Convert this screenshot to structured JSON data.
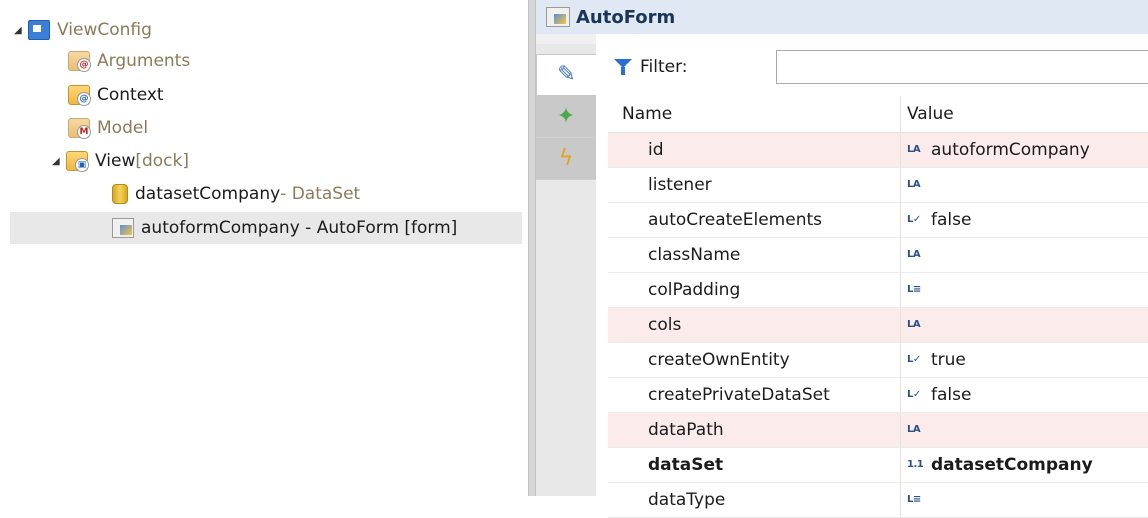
{
  "tree": {
    "items": [
      {
        "label": "ViewConfig",
        "suffix": "",
        "icon": "viewconfig-icon",
        "expanded": true,
        "gray": true
      },
      {
        "label": "Arguments",
        "suffix": "",
        "icon": "arguments-folder-icon",
        "gray": true
      },
      {
        "label": "Context",
        "suffix": "",
        "icon": "context-folder-icon",
        "gray": false
      },
      {
        "label": "Model",
        "suffix": "",
        "icon": "model-folder-icon",
        "gray": true
      },
      {
        "label": "View",
        "suffix": " [dock]",
        "icon": "view-folder-icon",
        "expanded": true,
        "gray": false
      },
      {
        "label": "datasetCompany",
        "suffix": " - DataSet",
        "icon": "dataset-icon",
        "gray": false
      },
      {
        "label": "autoformCompany - AutoForm [form]",
        "suffix": "",
        "icon": "autoform-icon",
        "gray": false,
        "selected": true
      }
    ]
  },
  "properties": {
    "title": "AutoForm",
    "filter": {
      "label": "Filter:",
      "value": "",
      "placeholder": ""
    },
    "columns": {
      "name": "Name",
      "value": "Value"
    },
    "rows": [
      {
        "name": "id",
        "type_icon": "LA",
        "value": "autoformCompany",
        "highlight": true,
        "bold": false
      },
      {
        "name": "listener",
        "type_icon": "LA",
        "value": "",
        "highlight": false,
        "bold": false
      },
      {
        "name": "autoCreateElements",
        "type_icon": "L✓",
        "value": "false",
        "highlight": false,
        "bold": false
      },
      {
        "name": "className",
        "type_icon": "LA",
        "value": "",
        "highlight": false,
        "bold": false
      },
      {
        "name": "colPadding",
        "type_icon": "L≡",
        "value": "",
        "highlight": false,
        "bold": false
      },
      {
        "name": "cols",
        "type_icon": "LA",
        "value": "",
        "highlight": true,
        "bold": false
      },
      {
        "name": "createOwnEntity",
        "type_icon": "L✓",
        "value": "true",
        "highlight": false,
        "bold": false
      },
      {
        "name": "createPrivateDataSet",
        "type_icon": "L✓",
        "value": "false",
        "highlight": false,
        "bold": false
      },
      {
        "name": "dataPath",
        "type_icon": "LA",
        "value": "",
        "highlight": true,
        "bold": false
      },
      {
        "name": "dataSet",
        "type_icon": "1.1",
        "value": "datasetCompany",
        "highlight": false,
        "bold": true
      },
      {
        "name": "dataType",
        "type_icon": "L≡",
        "value": "",
        "highlight": false,
        "bold": false
      }
    ]
  },
  "colors": {
    "header_bg": "#dfe8f3",
    "highlight_row": "#fbeceb",
    "selection": "#e8e8e8",
    "accent": "#2b6fd6"
  }
}
